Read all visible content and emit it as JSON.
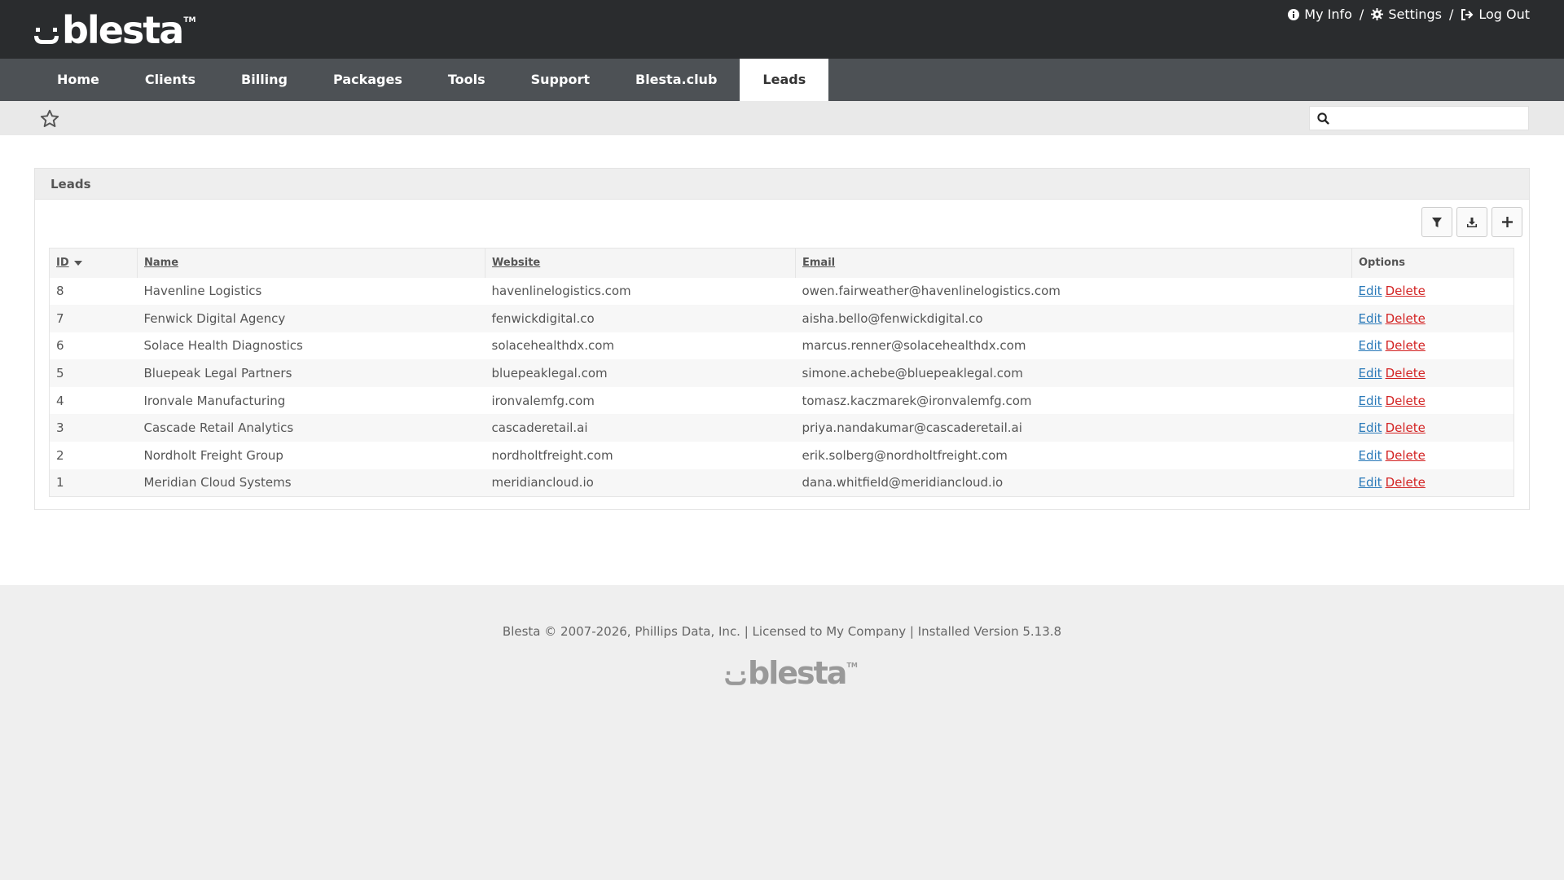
{
  "brand": {
    "name": "blesta",
    "tm": "TM"
  },
  "top_links": [
    {
      "label": "My Info",
      "icon": "info-circle-icon"
    },
    {
      "label": "Settings",
      "icon": "gear-icon"
    },
    {
      "label": "Log Out",
      "icon": "sign-out-icon"
    }
  ],
  "top_separator": "/",
  "nav": [
    {
      "label": "Home"
    },
    {
      "label": "Clients"
    },
    {
      "label": "Billing"
    },
    {
      "label": "Packages"
    },
    {
      "label": "Tools"
    },
    {
      "label": "Support"
    },
    {
      "label": "Blesta.club"
    },
    {
      "label": "Leads",
      "active": true
    }
  ],
  "search": {
    "placeholder": "",
    "value": ""
  },
  "panel": {
    "title": "Leads",
    "toolbar": [
      "filter-icon",
      "download-icon",
      "plus-icon"
    ]
  },
  "table": {
    "columns": {
      "id": "ID",
      "name": "Name",
      "website": "Website",
      "email": "Email",
      "options": "Options"
    },
    "sort": {
      "column": "ID",
      "direction": "desc"
    },
    "rows": [
      {
        "id": "8",
        "name": "Havenline Logistics",
        "website": "havenlinelogistics.com",
        "email": "owen.fairweather@havenlinelogistics.com"
      },
      {
        "id": "7",
        "name": "Fenwick Digital Agency",
        "website": "fenwickdigital.co",
        "email": "aisha.bello@fenwickdigital.co"
      },
      {
        "id": "6",
        "name": "Solace Health Diagnostics",
        "website": "solacehealthdx.com",
        "email": "marcus.renner@solacehealthdx.com"
      },
      {
        "id": "5",
        "name": "Bluepeak Legal Partners",
        "website": "bluepeaklegal.com",
        "email": "simone.achebe@bluepeaklegal.com"
      },
      {
        "id": "4",
        "name": "Ironvale Manufacturing",
        "website": "ironvalemfg.com",
        "email": "tomasz.kaczmarek@ironvalemfg.com"
      },
      {
        "id": "3",
        "name": "Cascade Retail Analytics",
        "website": "cascaderetail.ai",
        "email": "priya.nandakumar@cascaderetail.ai"
      },
      {
        "id": "2",
        "name": "Nordholt Freight Group",
        "website": "nordholtfreight.com",
        "email": "erik.solberg@nordholtfreight.com"
      },
      {
        "id": "1",
        "name": "Meridian Cloud Systems",
        "website": "meridiancloud.io",
        "email": "dana.whitfield@meridiancloud.io"
      }
    ],
    "edit_label": "Edit",
    "delete_label": "Delete"
  },
  "footer": {
    "text": "Blesta © 2007-2026, Phillips Data, Inc. | Licensed to My Company | Installed Version 5.13.8"
  },
  "colors": {
    "topbar": "#2a2c2e",
    "navbar": "#4d5155",
    "edit_link": "#2b7ab9",
    "delete_link": "#d32323"
  }
}
